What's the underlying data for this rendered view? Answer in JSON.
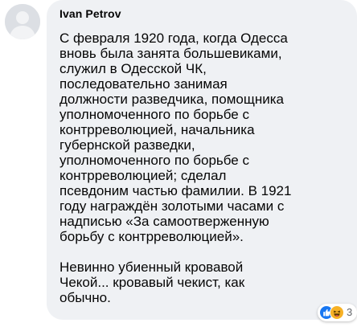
{
  "comment": {
    "author": "Ivan Petrov",
    "lines": [
      "С февраля 1920 года, когда Одесса",
      "вновь была занята большевиками,",
      "служил в Одесской ЧК,",
      "последовательно занимая",
      "должности разведчика, помощника",
      "уполномоченного по борьбе с",
      "контрреволюцией, начальника",
      "губернской разведки,",
      "уполномоченного по борьбе с",
      "контрреволюцией; сделал",
      "псевдоним частью фамилии. В 1921",
      "году награждён золотыми часами с",
      "надписью «За самоотверженную",
      "борьбу с контрреволюцией».",
      "",
      "Невинно убиенный кровавой",
      "Чекой... кровавый чекист, как",
      "обычно."
    ],
    "reactions": {
      "icons": [
        "like-icon",
        "haha-icon"
      ],
      "count": "3"
    }
  },
  "colors": {
    "bubble": "#eff1f4",
    "text": "#050505",
    "like": "#1877f2",
    "haha": "#f7b125",
    "muted": "#65676b"
  }
}
